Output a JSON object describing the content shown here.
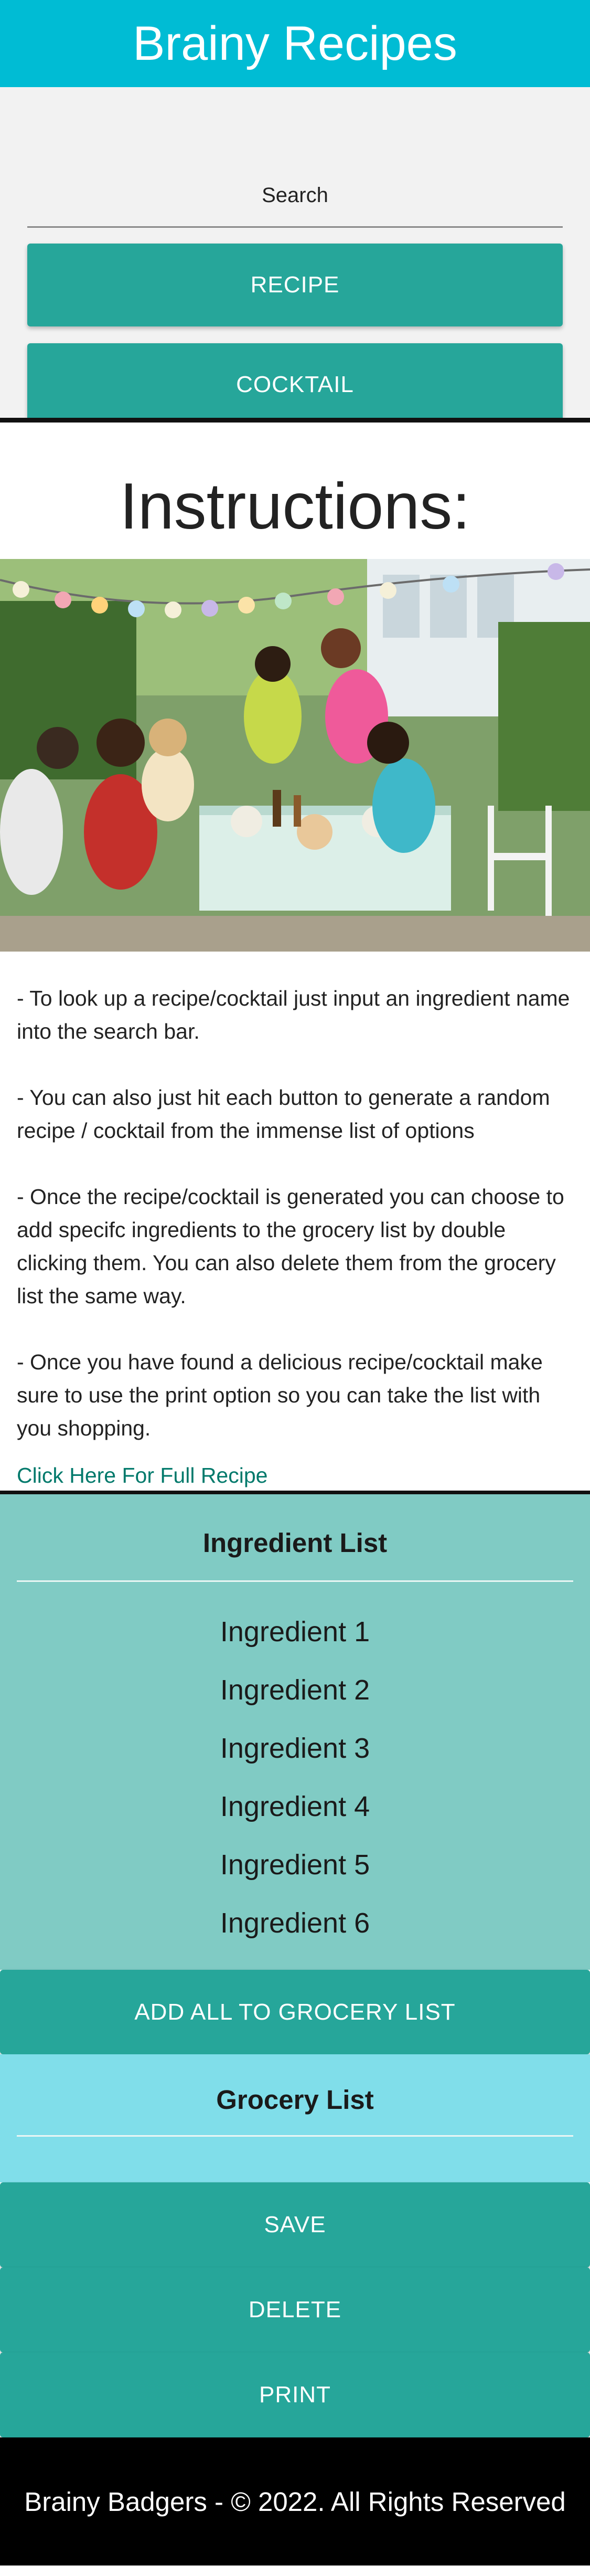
{
  "header": {
    "title": "Brainy Recipes"
  },
  "search": {
    "placeholder": "Search"
  },
  "buttons": {
    "recipe": "RECIPE",
    "cocktail": "COCKTAIL"
  },
  "instructions": {
    "title": "Instructions:",
    "paragraphs": [
      "- To look up a recipe/cocktail just input an ingredient name into the search bar.",
      "- You can also just hit each button to generate a random recipe / cocktail from the immense list of options",
      "- Once the recipe/cocktail is generated you can choose to add specifc ingredients to the grocery list by double clicking them. You can also delete them from the grocery list the same way.",
      "- Once you have found a delicious recipe/cocktail make sure to use the print option so you can take the list with you shopping."
    ],
    "link": "Click Here For Full Recipe"
  },
  "ingredients": {
    "heading": "Ingredient List",
    "items": [
      "Ingredient 1",
      "Ingredient 2",
      "Ingredient 3",
      "Ingredient 4",
      "Ingredient 5",
      "Ingredient 6"
    ],
    "add_all": "ADD ALL TO GROCERY LIST"
  },
  "grocery": {
    "heading": "Grocery List"
  },
  "actions": {
    "save": "SAVE",
    "delete": "DELETE",
    "print": "PRINT"
  },
  "footer": {
    "text": "Brainy Badgers - © 2022. All Rights Reserved"
  },
  "colors": {
    "header": "#00bcd4",
    "teal_button": "#26a69a",
    "ingredient_bg": "#80cbc4",
    "grocery_bg": "#80deea",
    "link": "#00796b"
  }
}
